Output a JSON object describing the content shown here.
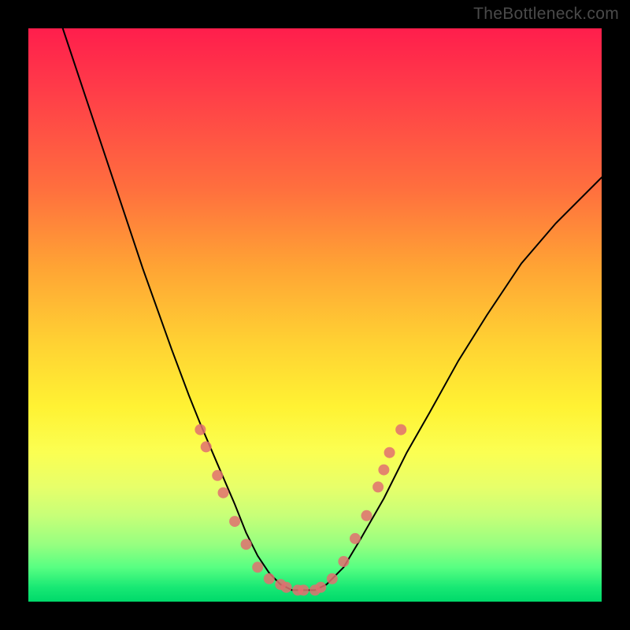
{
  "watermark": "TheBottleneck.com",
  "colors": {
    "frame": "#000000",
    "gradient_top": "#ff1e4c",
    "gradient_bottom": "#00d96a",
    "curve": "#000000",
    "dots": "#e07070"
  },
  "chart_data": {
    "type": "line",
    "title": "",
    "xlabel": "",
    "ylabel": "",
    "xlim": [
      0,
      100
    ],
    "ylim": [
      0,
      100
    ],
    "note": "Single V-shaped bottleneck curve with scattered sample dots near the valley. Axes carry no tick labels in the source image; values are normalized 0–100.",
    "series": [
      {
        "name": "bottleneck-curve",
        "x": [
          6,
          10,
          15,
          20,
          25,
          28,
          30,
          33,
          36,
          38,
          40,
          42,
          44,
          46,
          48,
          50,
          52,
          55,
          58,
          62,
          66,
          70,
          75,
          80,
          86,
          92,
          100
        ],
        "y": [
          100,
          88,
          73,
          58,
          44,
          36,
          31,
          24,
          17,
          12,
          8,
          5,
          3,
          2,
          2,
          2,
          3,
          6,
          11,
          18,
          26,
          33,
          42,
          50,
          59,
          66,
          74
        ]
      }
    ],
    "dots": [
      {
        "x": 30,
        "y": 30
      },
      {
        "x": 31,
        "y": 27
      },
      {
        "x": 33,
        "y": 22
      },
      {
        "x": 34,
        "y": 19
      },
      {
        "x": 36,
        "y": 14
      },
      {
        "x": 38,
        "y": 10
      },
      {
        "x": 40,
        "y": 6
      },
      {
        "x": 42,
        "y": 4
      },
      {
        "x": 44,
        "y": 3
      },
      {
        "x": 45,
        "y": 2.5
      },
      {
        "x": 47,
        "y": 2
      },
      {
        "x": 48,
        "y": 2
      },
      {
        "x": 50,
        "y": 2
      },
      {
        "x": 51,
        "y": 2.5
      },
      {
        "x": 53,
        "y": 4
      },
      {
        "x": 55,
        "y": 7
      },
      {
        "x": 57,
        "y": 11
      },
      {
        "x": 59,
        "y": 15
      },
      {
        "x": 61,
        "y": 20
      },
      {
        "x": 62,
        "y": 23
      },
      {
        "x": 63,
        "y": 26
      },
      {
        "x": 65,
        "y": 30
      }
    ]
  }
}
